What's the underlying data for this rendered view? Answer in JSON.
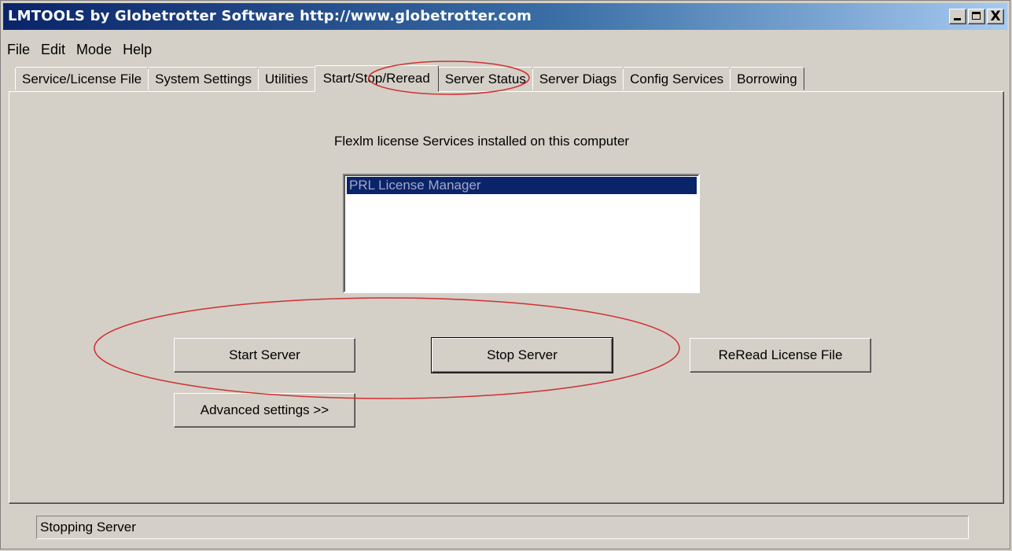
{
  "window": {
    "title": "LMTOOLS by Globetrotter Software http://www.globetrotter.com",
    "controls": {
      "minimize_icon": "minimize-icon",
      "maximize_icon": "maximize-icon",
      "close_label": "X"
    }
  },
  "menu": [
    "File",
    "Edit",
    "Mode",
    "Help"
  ],
  "tabs": [
    {
      "label": "Service/License File"
    },
    {
      "label": "System Settings"
    },
    {
      "label": "Utilities"
    },
    {
      "label": "Start/Stop/Reread",
      "active": true
    },
    {
      "label": "Server Status"
    },
    {
      "label": "Server Diags"
    },
    {
      "label": "Config Services"
    },
    {
      "label": "Borrowing"
    }
  ],
  "panel": {
    "services_label": "Flexlm license Services installed on this computer",
    "services": [
      "PRL License Manager"
    ],
    "selected_service": "PRL License Manager",
    "buttons": {
      "start": "Start Server",
      "stop": "Stop Server",
      "reread": "ReRead License File",
      "advanced": "Advanced settings >>"
    }
  },
  "status": {
    "text": "Stopping Server"
  },
  "colors": {
    "face": "#d4d0c8",
    "title_gradient_start": "#0a246a",
    "title_gradient_end": "#a6caf0",
    "selection": "#0a246a",
    "annotation": "#d03030"
  }
}
